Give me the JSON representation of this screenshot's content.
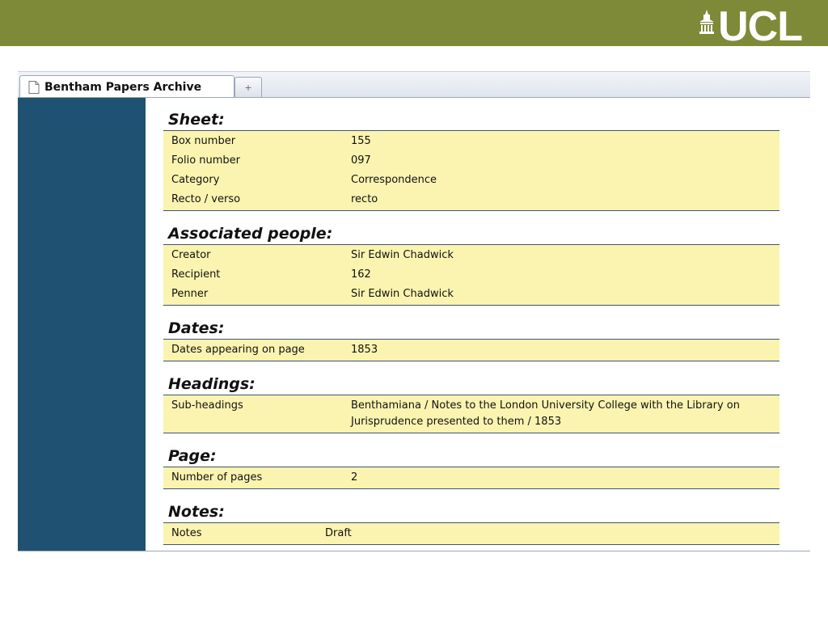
{
  "header": {
    "logo_text": "UCL"
  },
  "browser": {
    "tab_title": "Bentham Papers Archive",
    "new_tab_glyph": "+"
  },
  "sections": {
    "sheet": {
      "title": "Sheet:",
      "rows": [
        {
          "label": "Box number",
          "value": "155"
        },
        {
          "label": "Folio number",
          "value": "097"
        },
        {
          "label": "Category",
          "value": "Correspondence"
        },
        {
          "label": "Recto / verso",
          "value": "recto"
        }
      ]
    },
    "people": {
      "title": "Associated people:",
      "rows": [
        {
          "label": "Creator",
          "value": "Sir Edwin Chadwick"
        },
        {
          "label": "Recipient",
          "value": "162"
        },
        {
          "label": "Penner",
          "value": "Sir Edwin Chadwick"
        }
      ]
    },
    "dates": {
      "title": "Dates:",
      "rows": [
        {
          "label": "Dates appearing on page",
          "value": "1853"
        }
      ]
    },
    "headings": {
      "title": "Headings:",
      "rows": [
        {
          "label": "Sub-headings",
          "value": "Benthamiana / Notes to the London University College with the Library on Jurisprudence presented to them / 1853"
        }
      ]
    },
    "page": {
      "title": "Page:",
      "rows": [
        {
          "label": "Number of pages",
          "value": "2"
        }
      ]
    },
    "notes": {
      "title": "Notes:",
      "rows": [
        {
          "label": "Notes",
          "value": "Draft"
        }
      ]
    }
  },
  "colors": {
    "banner": "#7e8a38",
    "sidebar": "#1f5272",
    "table_bg": "#fbf4b0",
    "rule": "#3c5570"
  }
}
